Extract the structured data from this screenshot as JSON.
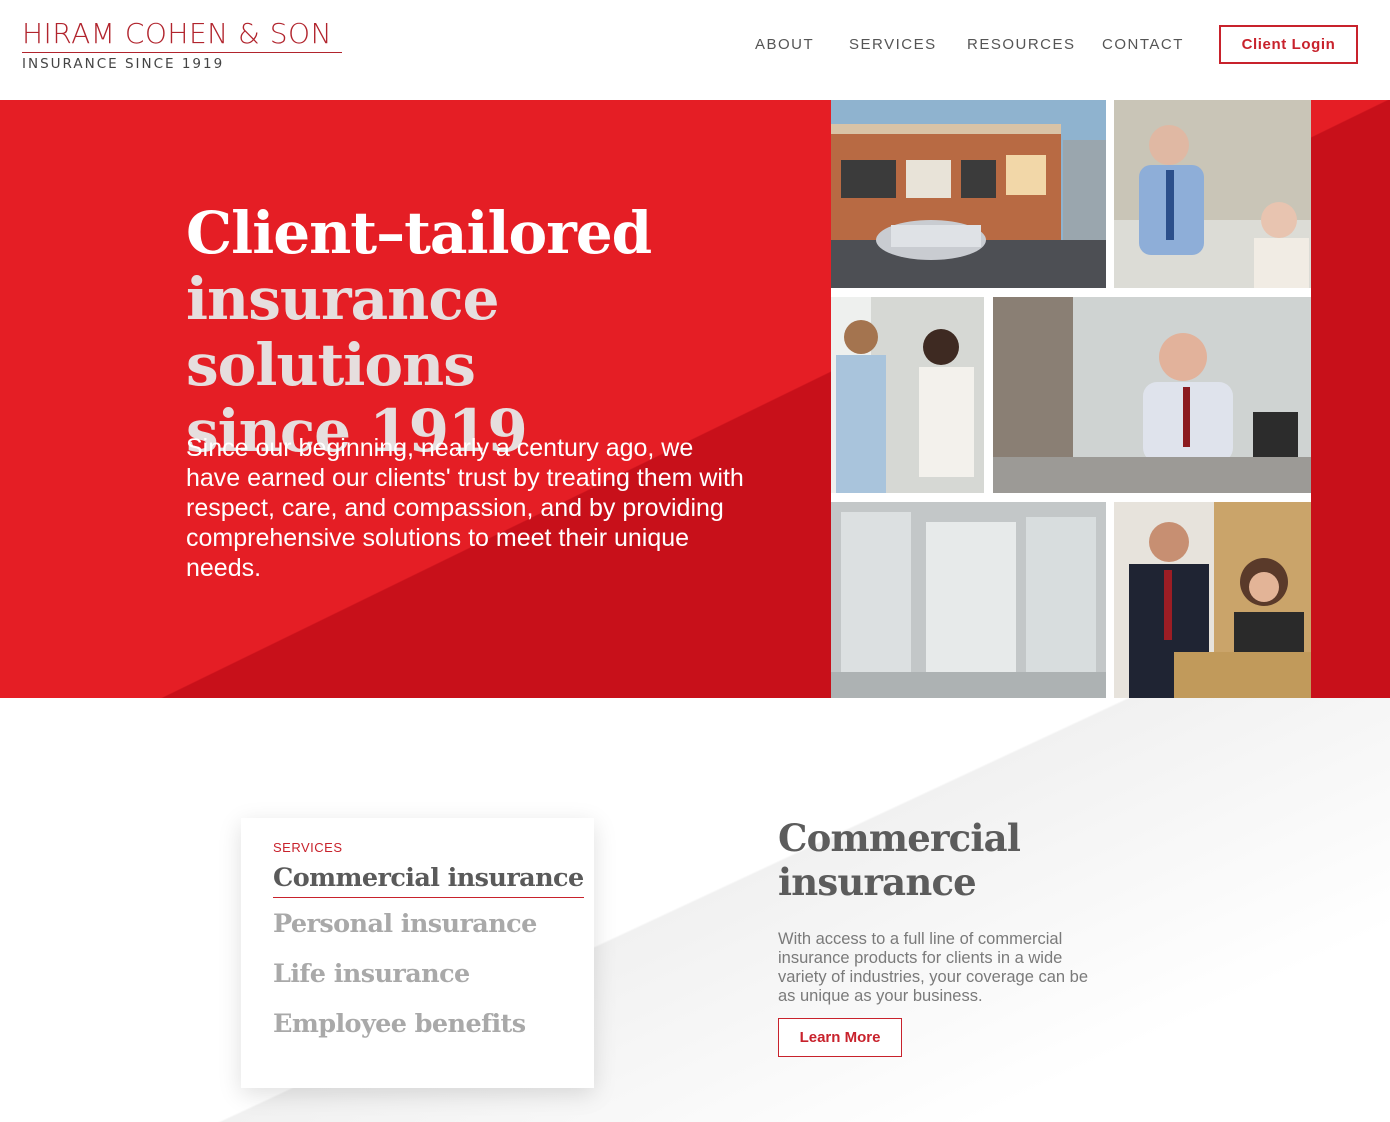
{
  "brand": {
    "name": "HIRAM COHEN & SON",
    "tagline": "INSURANCE SINCE 1919",
    "accent_color": "#c8222c",
    "hero_color": "#e51e25"
  },
  "nav": {
    "items": [
      {
        "label": "ABOUT"
      },
      {
        "label": "SERVICES"
      },
      {
        "label": "RESOURCES"
      },
      {
        "label": "CONTACT"
      }
    ],
    "login_label": "Client Login"
  },
  "hero": {
    "title_line1": "Client–tailored",
    "title_line2": "insurance solutions",
    "title_line3": "since 1919",
    "body": "Since our beginning, nearly a century ago, we have earned our clients' trust by treating them with respect, care, and compassion, and by providing comprehensive solutions to meet their unique needs."
  },
  "services": {
    "label": "SERVICES",
    "items": [
      {
        "label": "Commercial insurance",
        "active": true
      },
      {
        "label": "Personal insurance",
        "active": false
      },
      {
        "label": "Life insurance",
        "active": false
      },
      {
        "label": "Employee benefits",
        "active": false
      }
    ]
  },
  "detail": {
    "title_line1": "Commercial",
    "title_line2": "insurance",
    "body": "With access to a full line of commercial insurance products for clients in a wide variety of industries, your coverage can be as unique as your business.",
    "button_label": "Learn More"
  }
}
